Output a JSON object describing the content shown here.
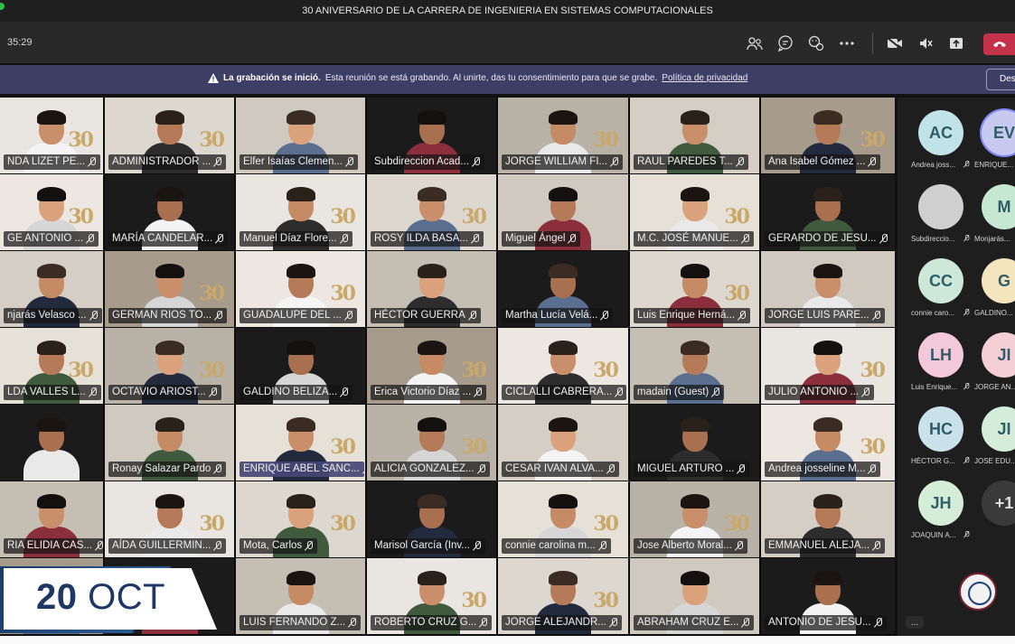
{
  "window": {
    "title": "30 ANIVERSARIO DE LA CARRERA DE INGENIERIA EN SISTEMAS COMPUTACIONALES"
  },
  "toolbar": {
    "timer": "35:29",
    "icons": [
      "people-icon",
      "chat-icon",
      "reactions-icon",
      "more-icon",
      "camera-off-icon",
      "mic-off-icon",
      "share-icon",
      "leave-icon"
    ],
    "leave_color": "#c4314b"
  },
  "banner": {
    "title": "La grabación se inició.",
    "message": "Esta reunión se está grabando. Al unirte, das tu consentimiento para que se grabe.",
    "link": "Política de privacidad",
    "dismiss": "Des"
  },
  "tiles": [
    [
      "NDA LIZET PE...",
      "ADMINISTRADOR ...",
      "Elfer Isaías Clemen...",
      "Subdireccion Acad...",
      "JORGE WILLIAM FI...",
      "RAUL PAREDES  T...",
      "Ana Isabel Gómez ..."
    ],
    [
      "GE ANTONIO ...",
      "MARÍA CANDELAR...",
      "Manuel Díaz Flore...",
      "ROSY  ILDA BASA...",
      "Miguel Ángel",
      "M.C. JOSÉ MANUE...",
      "GERARDO DE JESU..."
    ],
    [
      "njarás Velasco ...",
      "GERMAN RIOS  TO...",
      "GUADALUPE DEL ...",
      "HÉCTOR GUERRA",
      "Martha Lucía Velá...",
      "Luis Enrique Herná...",
      "JORGE LUIS PARE..."
    ],
    [
      "LDA VALLES  L...",
      "OCTAVIO ARIOST...",
      "GALDINO  BELIZA...",
      "Erica Victorio Díaz ...",
      "CICLALLI CABRERA...",
      "madain (Guest)",
      "JULIO ANTONIO ..."
    ],
    [
      "",
      "Ronay Salazar Pardo",
      "ENRIQUE ABEL SANC...",
      "ALICIA GONZALEZ...",
      "CESAR IVAN ALVA...",
      "MIGUEL ARTURO ...",
      "Andrea josseline M..."
    ],
    [
      "RIA ELIDIA CAS...",
      "AÍDA GUILLERMIN...",
      "Mota, Carlos",
      "Marisol García (Inv...",
      "connie carolina m...",
      "Jose Alberto Moral...",
      "EMMANUEL ALEJA..."
    ],
    [
      "",
      "",
      "LUIS FERNANDO Z...",
      "ROBERTO CRUZ  G...",
      "JORGE ALEJANDR...",
      "ABRAHAM CRUZ E...",
      "ANTONIO DE JESU..."
    ]
  ],
  "speaker_tile": "ENRIQUE ABEL SANC...",
  "roster": [
    {
      "initials": "AC",
      "name": "Andrea joss...",
      "color": "#bfe3e6"
    },
    {
      "initials": "EV",
      "name": "ENRIQUE...",
      "color": "#c7c9f0"
    },
    {
      "initials": "",
      "name": "Subdireccio...",
      "color": "#cfcfcf"
    },
    {
      "initials": "M",
      "name": "Monjarás...",
      "color": "#c6e8d2"
    },
    {
      "initials": "CC",
      "name": "connie caro...",
      "color": "#cde8d9"
    },
    {
      "initials": "G",
      "name": "GALDINO...",
      "color": "#f3e5bd"
    },
    {
      "initials": "LH",
      "name": "Luis Enrique...",
      "color": "#f3c9d9"
    },
    {
      "initials": "JI",
      "name": "JORGE AN...",
      "color": "#f5cfd6"
    },
    {
      "initials": "HC",
      "name": "HÉCTOR G...",
      "color": "#c9e2ea"
    },
    {
      "initials": "JI",
      "name": "JOSE EDU...",
      "color": "#d3edd9"
    },
    {
      "initials": "JH",
      "name": "JOAQUIN A...",
      "color": "#d3edd6"
    },
    {
      "initials": "+1",
      "name": "",
      "color": "#3a3a3a"
    }
  ],
  "more_label": "...",
  "date_overlay": {
    "day": "20",
    "month": "OCT"
  }
}
